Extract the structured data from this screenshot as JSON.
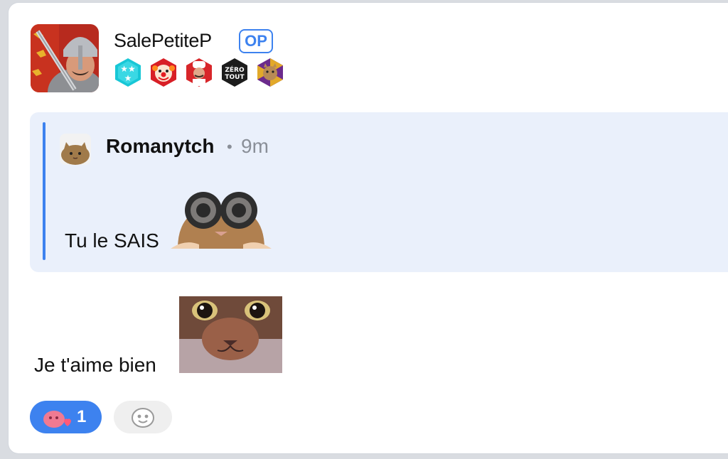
{
  "post": {
    "author": "SalePetiteP",
    "op_label": "OP",
    "badges": [
      "stars-badge-icon",
      "clown-badge-icon",
      "chef-badge-icon",
      "zero-tout-badge-icon",
      "cat-spiral-badge-icon"
    ],
    "badge_zero_text_1": "ZÉRO",
    "badge_zero_text_2": "TOUT"
  },
  "quote": {
    "author": "Romanytch",
    "separator": "•",
    "time": "9m",
    "text": "Tu le SAIS"
  },
  "message": {
    "text": "Je t'aime bien"
  },
  "reactions": {
    "count": "1"
  },
  "colors": {
    "accent": "#3d82ef",
    "quote_bg": "#eaf0fb",
    "page_bg": "#d9dce1"
  }
}
